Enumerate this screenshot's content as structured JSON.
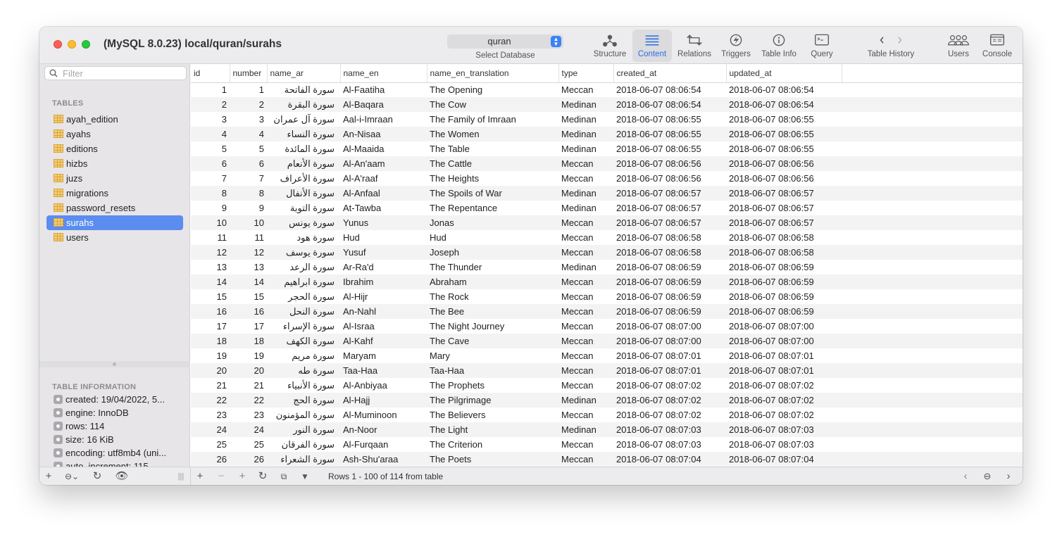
{
  "window": {
    "title": "(MySQL 8.0.23) local/quran/surahs"
  },
  "toolbar": {
    "database": {
      "value": "quran",
      "caption": "Select Database"
    },
    "buttons": [
      {
        "label": "Structure",
        "icon": "structure-icon"
      },
      {
        "label": "Content",
        "icon": "content-icon",
        "active": true
      },
      {
        "label": "Relations",
        "icon": "relations-icon"
      },
      {
        "label": "Triggers",
        "icon": "triggers-icon"
      },
      {
        "label": "Table Info",
        "icon": "info-icon"
      },
      {
        "label": "Query",
        "icon": "query-icon"
      },
      {
        "label": "Table History",
        "icon": "history-arrows-icon"
      },
      {
        "label": "Users",
        "icon": "users-icon"
      },
      {
        "label": "Console",
        "icon": "console-icon"
      }
    ]
  },
  "sidebar": {
    "search_placeholder": "Filter",
    "tables_heading": "TABLES",
    "tables": [
      "ayah_edition",
      "ayahs",
      "editions",
      "hizbs",
      "juzs",
      "migrations",
      "password_resets",
      "surahs",
      "users"
    ],
    "selected_table": "surahs",
    "info_heading": "TABLE INFORMATION",
    "info": [
      "created: 19/04/2022, 5...",
      "engine: InnoDB",
      "rows: 114",
      "size: 16 KiB",
      "encoding: utf8mb4 (uni...",
      "auto_increment: 115"
    ]
  },
  "grid": {
    "columns": [
      "id",
      "number",
      "name_ar",
      "name_en",
      "name_en_translation",
      "type",
      "created_at",
      "updated_at"
    ],
    "rows": [
      [
        "1",
        "1",
        "سورة الفاتحة",
        "Al-Faatiha",
        "The Opening",
        "Meccan",
        "2018-06-07 08:06:54",
        "2018-06-07 08:06:54"
      ],
      [
        "2",
        "2",
        "سورة البقرة",
        "Al-Baqara",
        "The Cow",
        "Medinan",
        "2018-06-07 08:06:54",
        "2018-06-07 08:06:54"
      ],
      [
        "3",
        "3",
        "سورة آل عمران",
        "Aal-i-Imraan",
        "The Family of Imraan",
        "Medinan",
        "2018-06-07 08:06:55",
        "2018-06-07 08:06:55"
      ],
      [
        "4",
        "4",
        "سورة النساء",
        "An-Nisaa",
        "The Women",
        "Medinan",
        "2018-06-07 08:06:55",
        "2018-06-07 08:06:55"
      ],
      [
        "5",
        "5",
        "سورة المائدة",
        "Al-Maaida",
        "The Table",
        "Medinan",
        "2018-06-07 08:06:55",
        "2018-06-07 08:06:55"
      ],
      [
        "6",
        "6",
        "سورة الأنعام",
        "Al-An'aam",
        "The Cattle",
        "Meccan",
        "2018-06-07 08:06:56",
        "2018-06-07 08:06:56"
      ],
      [
        "7",
        "7",
        "سورة الأعراف",
        "Al-A'raaf",
        "The Heights",
        "Meccan",
        "2018-06-07 08:06:56",
        "2018-06-07 08:06:56"
      ],
      [
        "8",
        "8",
        "سورة الأنفال",
        "Al-Anfaal",
        "The Spoils of War",
        "Medinan",
        "2018-06-07 08:06:57",
        "2018-06-07 08:06:57"
      ],
      [
        "9",
        "9",
        "سورة التوبة",
        "At-Tawba",
        "The Repentance",
        "Medinan",
        "2018-06-07 08:06:57",
        "2018-06-07 08:06:57"
      ],
      [
        "10",
        "10",
        "سورة يونس",
        "Yunus",
        "Jonas",
        "Meccan",
        "2018-06-07 08:06:57",
        "2018-06-07 08:06:57"
      ],
      [
        "11",
        "11",
        "سورة هود",
        "Hud",
        "Hud",
        "Meccan",
        "2018-06-07 08:06:58",
        "2018-06-07 08:06:58"
      ],
      [
        "12",
        "12",
        "سورة يوسف",
        "Yusuf",
        "Joseph",
        "Meccan",
        "2018-06-07 08:06:58",
        "2018-06-07 08:06:58"
      ],
      [
        "13",
        "13",
        "سورة الرعد",
        "Ar-Ra'd",
        "The Thunder",
        "Medinan",
        "2018-06-07 08:06:59",
        "2018-06-07 08:06:59"
      ],
      [
        "14",
        "14",
        "سورة ابراهيم",
        "Ibrahim",
        "Abraham",
        "Meccan",
        "2018-06-07 08:06:59",
        "2018-06-07 08:06:59"
      ],
      [
        "15",
        "15",
        "سورة الحجر",
        "Al-Hijr",
        "The Rock",
        "Meccan",
        "2018-06-07 08:06:59",
        "2018-06-07 08:06:59"
      ],
      [
        "16",
        "16",
        "سورة النحل",
        "An-Nahl",
        "The Bee",
        "Meccan",
        "2018-06-07 08:06:59",
        "2018-06-07 08:06:59"
      ],
      [
        "17",
        "17",
        "سورة الإسراء",
        "Al-Israa",
        "The Night Journey",
        "Meccan",
        "2018-06-07 08:07:00",
        "2018-06-07 08:07:00"
      ],
      [
        "18",
        "18",
        "سورة الكهف",
        "Al-Kahf",
        "The Cave",
        "Meccan",
        "2018-06-07 08:07:00",
        "2018-06-07 08:07:00"
      ],
      [
        "19",
        "19",
        "سورة مريم",
        "Maryam",
        "Mary",
        "Meccan",
        "2018-06-07 08:07:01",
        "2018-06-07 08:07:01"
      ],
      [
        "20",
        "20",
        "سورة طه",
        "Taa-Haa",
        "Taa-Haa",
        "Meccan",
        "2018-06-07 08:07:01",
        "2018-06-07 08:07:01"
      ],
      [
        "21",
        "21",
        "سورة الأنبياء",
        "Al-Anbiyaa",
        "The Prophets",
        "Meccan",
        "2018-06-07 08:07:02",
        "2018-06-07 08:07:02"
      ],
      [
        "22",
        "22",
        "سورة الحج",
        "Al-Hajj",
        "The Pilgrimage",
        "Medinan",
        "2018-06-07 08:07:02",
        "2018-06-07 08:07:02"
      ],
      [
        "23",
        "23",
        "سورة المؤمنون",
        "Al-Muminoon",
        "The Believers",
        "Meccan",
        "2018-06-07 08:07:02",
        "2018-06-07 08:07:02"
      ],
      [
        "24",
        "24",
        "سورة النور",
        "An-Noor",
        "The Light",
        "Medinan",
        "2018-06-07 08:07:03",
        "2018-06-07 08:07:03"
      ],
      [
        "25",
        "25",
        "سورة الفرقان",
        "Al-Furqaan",
        "The Criterion",
        "Meccan",
        "2018-06-07 08:07:03",
        "2018-06-07 08:07:03"
      ],
      [
        "26",
        "26",
        "سورة الشعراء",
        "Ash-Shu'araa",
        "The Poets",
        "Meccan",
        "2018-06-07 08:07:04",
        "2018-06-07 08:07:04"
      ]
    ]
  },
  "status": {
    "rows_text": "Rows 1 - 100 of 114 from table"
  }
}
